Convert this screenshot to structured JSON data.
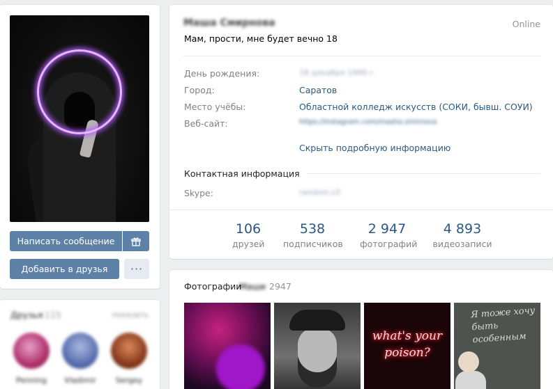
{
  "left": {
    "buttons": {
      "message": "Написать сообщение",
      "gift_icon": "gift-icon",
      "add_friend": "Добавить в друзья",
      "more": "···"
    },
    "friends": {
      "title": "Друзья",
      "count": "115",
      "link": "показать",
      "items": [
        {
          "name": "Penning"
        },
        {
          "name": "Vladimir"
        },
        {
          "name": "Sergey"
        }
      ]
    }
  },
  "profile": {
    "name": "Маша Смирнова",
    "online": "Online",
    "status": "Мам, прости, мне будет вечно 18",
    "details": [
      {
        "label": "День рождения:",
        "value": "18 декабря 1999 г."
      },
      {
        "label": "Город:",
        "value": "Саратов"
      },
      {
        "label": "Место учёбы:",
        "value": "Областной колледж искусств (СОКИ, бывш. СОУИ)"
      },
      {
        "label": "Веб-сайт:",
        "value": "https://instagram.com/masha.smirnova"
      }
    ],
    "hide_link": "Скрыть подробную информацию",
    "contacts_title": "Контактная информация",
    "contacts": [
      {
        "label": "Skype:",
        "value": "random.s3"
      }
    ],
    "counters": [
      {
        "num": "106",
        "label": "друзей"
      },
      {
        "num": "538",
        "label": "подписчиков"
      },
      {
        "num": "2 947",
        "label": "фотографий"
      },
      {
        "num": "4 893",
        "label": "видеозаписи"
      }
    ]
  },
  "photos": {
    "title": "Фотографии",
    "owner": "Маши",
    "count": "2947",
    "neon_text": "what's your poison?",
    "board_text": "Я тоже хочу быть особенным"
  }
}
